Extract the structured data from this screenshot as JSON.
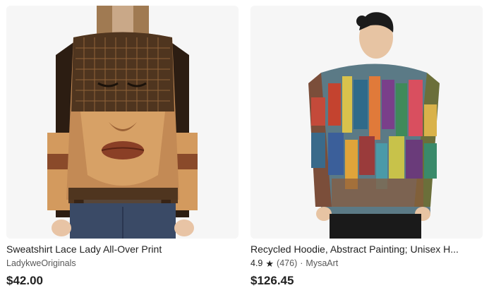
{
  "listings": [
    {
      "title": "Sweatshirt Lace Lady All-Over Print",
      "shop": "LadykweOriginals",
      "price": "$42.00"
    },
    {
      "title": "Recycled Hoodie, Abstract Painting; Unisex H...",
      "rating": "4.9",
      "star_icon": "★",
      "review_count": "(476)",
      "separator": "·",
      "shop": "MysaArt",
      "price": "$126.45"
    }
  ]
}
